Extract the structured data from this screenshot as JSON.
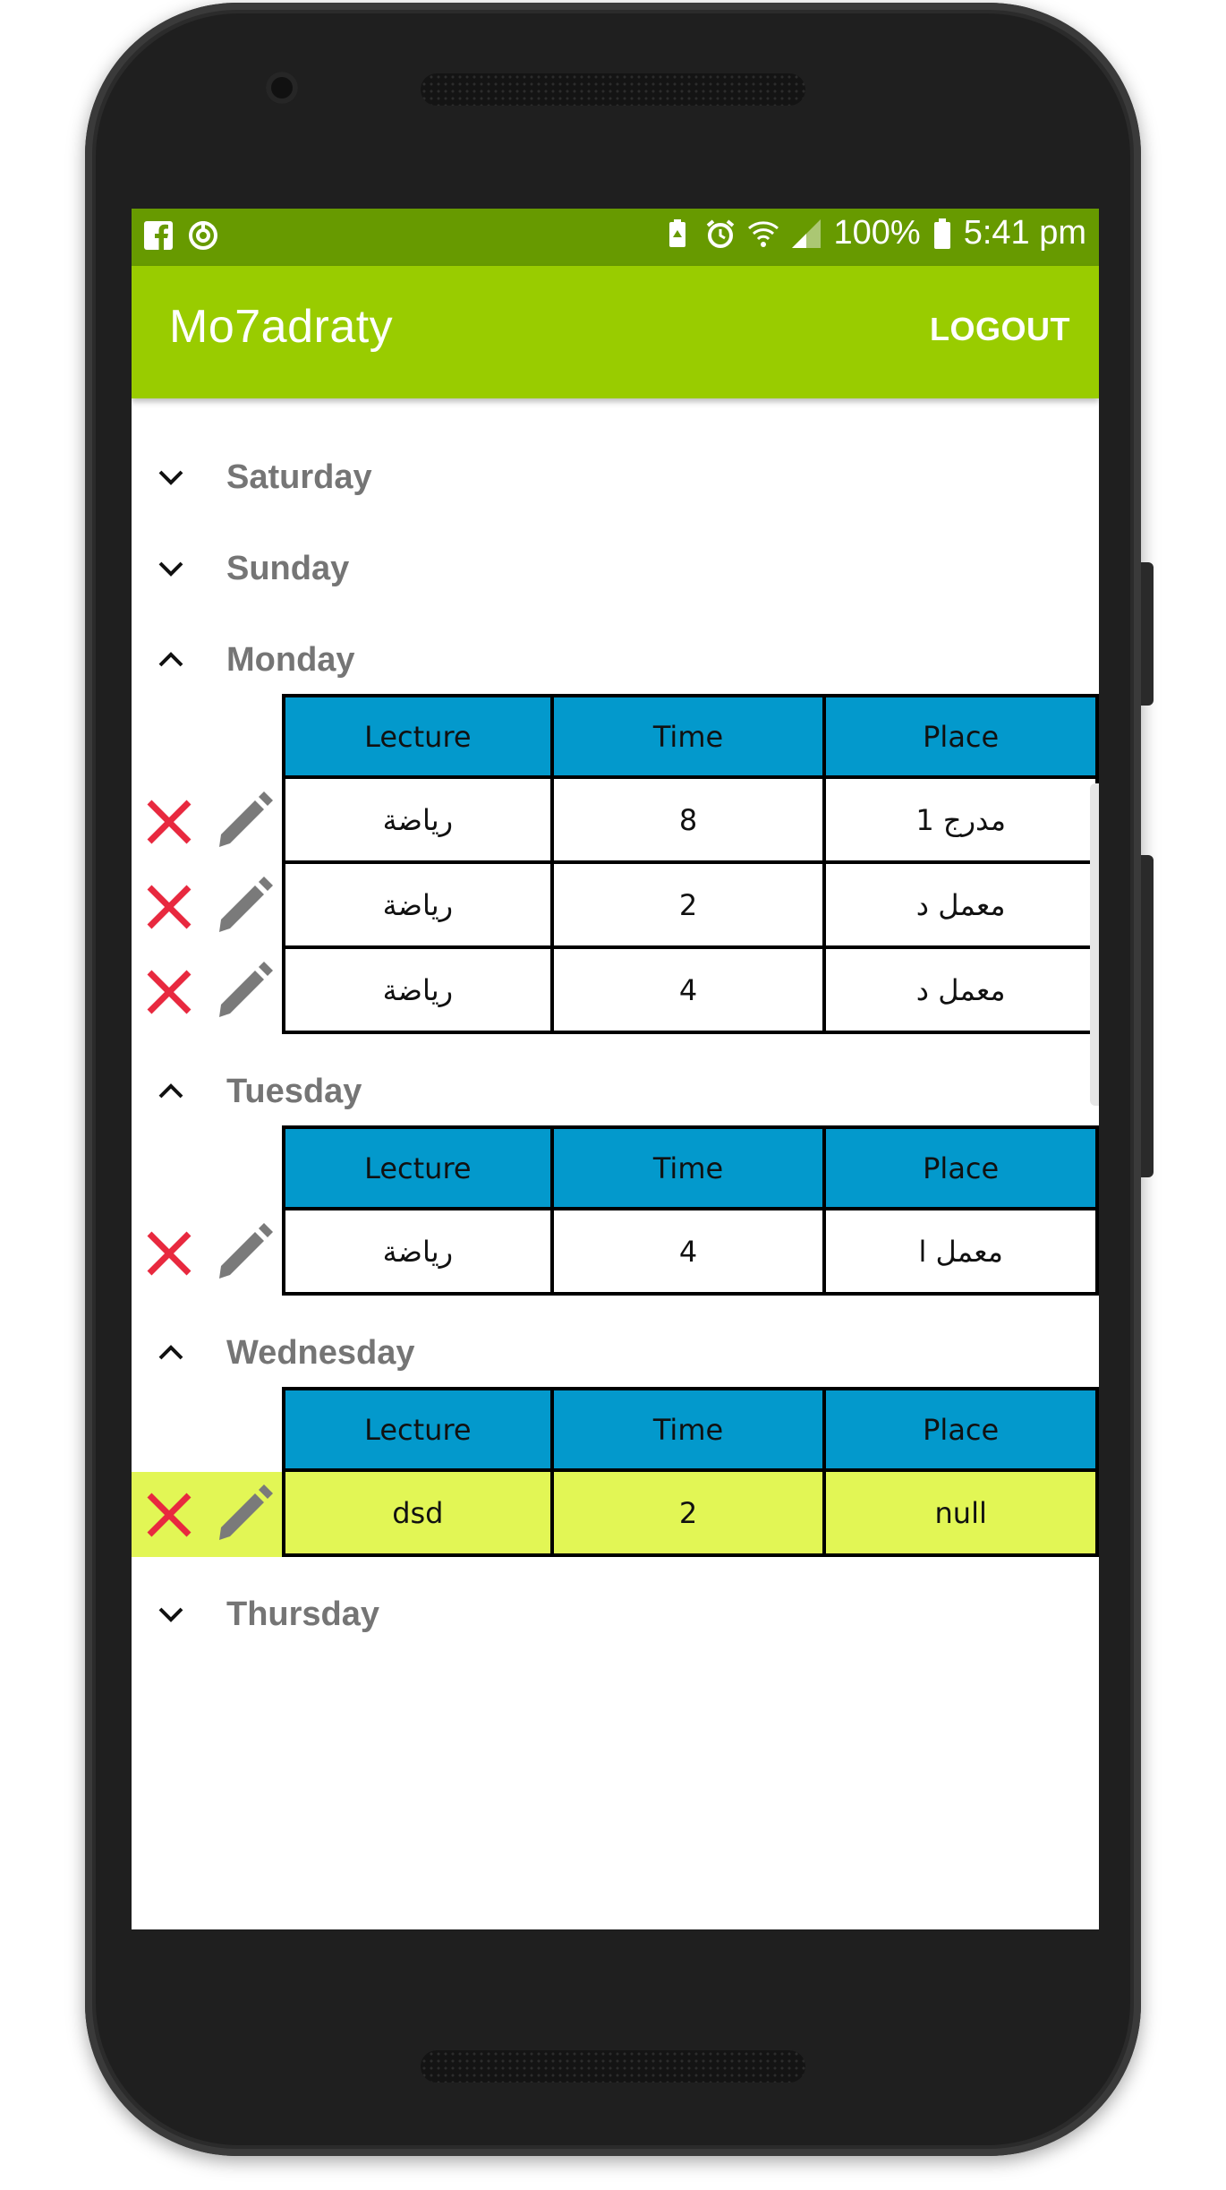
{
  "status_bar": {
    "battery_percent": "100%",
    "time": "5:41 pm",
    "left_icons": [
      "facebook-icon",
      "sync-icon"
    ],
    "right_icons": [
      "battery-saver-icon",
      "alarm-icon",
      "wifi-icon",
      "signal-icon",
      "battery-icon"
    ]
  },
  "app_bar": {
    "title": "Mo7adraty",
    "logout_label": "LOGOUT",
    "color": "#99cc00",
    "status_color": "#679a00"
  },
  "table_header": {
    "lecture": "Lecture",
    "time": "Time",
    "place": "Place",
    "color": "#0399cc"
  },
  "highlight_color": "#e2f655",
  "days": {
    "saturday": {
      "label": "Saturday",
      "expanded": false
    },
    "sunday": {
      "label": "Sunday",
      "expanded": false
    },
    "monday": {
      "label": "Monday",
      "expanded": true,
      "rows": [
        {
          "lecture": "رياضة",
          "time": "8",
          "place": "مدرج 1"
        },
        {
          "lecture": "رياضة",
          "time": "2",
          "place": "معمل د"
        },
        {
          "lecture": "رياضة",
          "time": "4",
          "place": "معمل د"
        }
      ]
    },
    "tuesday": {
      "label": "Tuesday",
      "expanded": true,
      "rows": [
        {
          "lecture": "رياضة",
          "time": "4",
          "place": "معمل ا"
        }
      ]
    },
    "wednesday": {
      "label": "Wednesday",
      "expanded": true,
      "rows": [
        {
          "lecture": "dsd",
          "time": "2",
          "place": "null"
        }
      ]
    },
    "thursday": {
      "label": "Thursday",
      "expanded": false
    }
  }
}
